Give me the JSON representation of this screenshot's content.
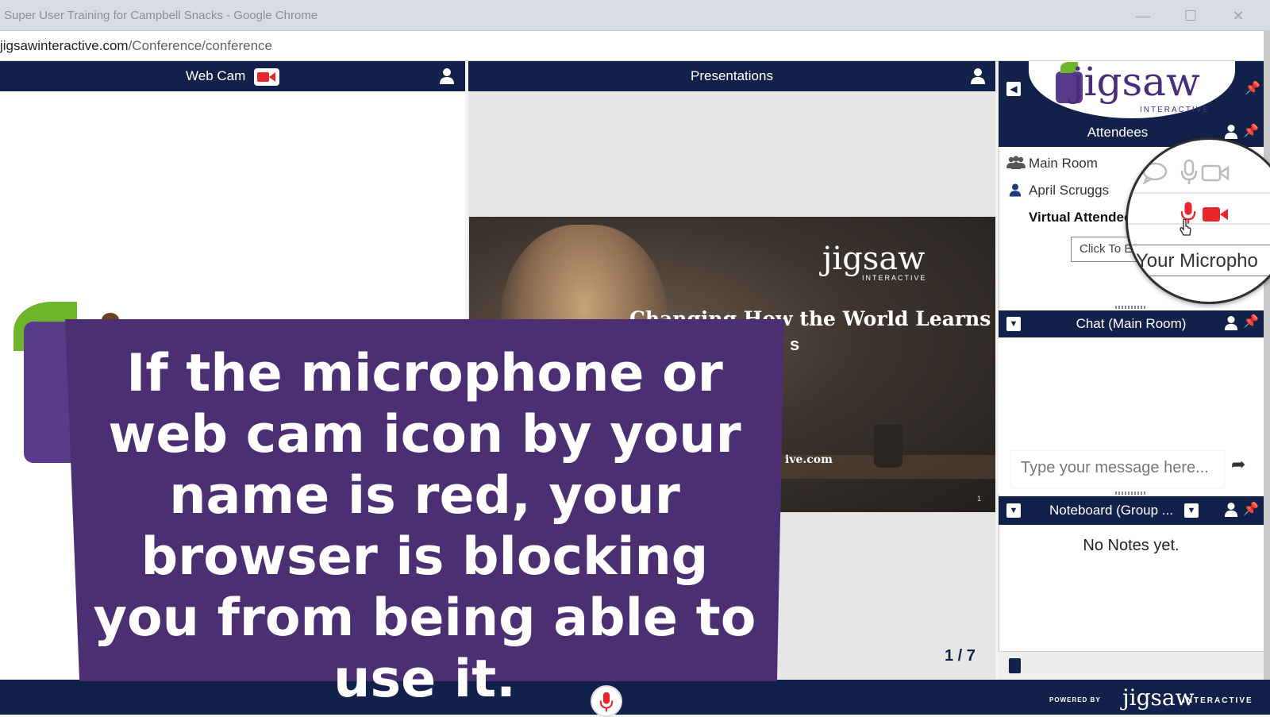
{
  "window": {
    "title": "Super User Training for Campbell Snacks - Google Chrome",
    "url_host": "jigsawinteractive.com",
    "url_path": "/Conference/conference"
  },
  "webcam_panel": {
    "title": "Web Cam"
  },
  "presentations_panel": {
    "title": "Presentations",
    "slide": {
      "logo": "jigsaw",
      "logo_sub": "INTERACTIVE",
      "headline": "Changing How the World Learns",
      "headline_line2": "s",
      "website": "ive.com",
      "page_mark": "1"
    },
    "pager": "1 / 7"
  },
  "brand": {
    "logo": "jigsaw",
    "logo_sub": "INTERACTIVE"
  },
  "attendees": {
    "title": "Attendees",
    "rows": [
      {
        "label": "Main Room"
      },
      {
        "label": "April Scruggs"
      },
      {
        "label": "Virtual Attendee"
      }
    ],
    "tooltip": "Click To E",
    "magnifier_tooltip": "Your Micropho"
  },
  "chat": {
    "title": "Chat (Main Room)",
    "placeholder": "Type your message here..."
  },
  "noteboard": {
    "title": "Noteboard (Group ...",
    "empty_text": "No Notes yet."
  },
  "footer": {
    "powered_by": "POWERED BY",
    "logo": "jigsaw",
    "logo_sub": "INTERACTIVE"
  },
  "caption": {
    "text": "If the microphone or web cam icon by your name is red, your browser is blocking you from being able to use it."
  },
  "colors": {
    "header_navy": "#12214a",
    "brand_purple": "#4c2f72",
    "alert_red": "#e8262b",
    "leaf_green": "#6fb52c"
  }
}
